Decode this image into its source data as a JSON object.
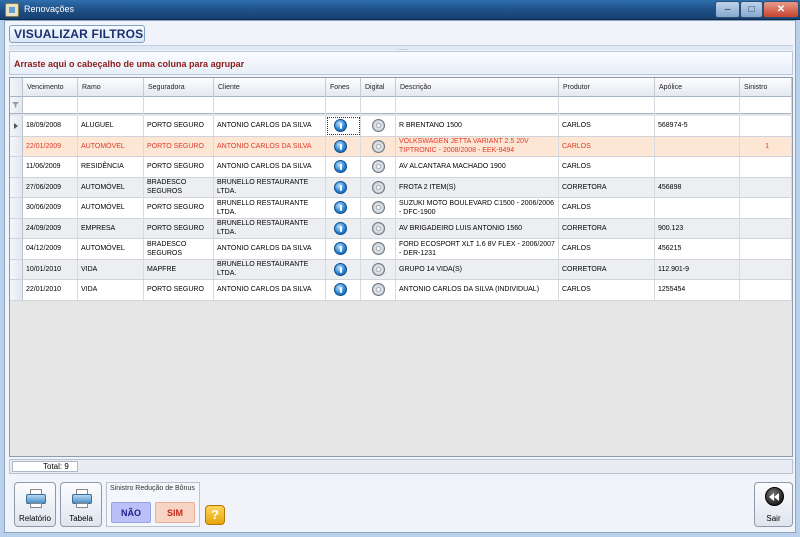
{
  "window": {
    "title": "Renovações",
    "minimize_label": "–",
    "maximize_label": "□",
    "close_label": "✕"
  },
  "toolbar": {
    "header_label": "VISUALIZAR FILTROS",
    "splitter_glyph": "....."
  },
  "grid": {
    "group_hint": "Arraste aqui o cabeçalho de uma coluna para agrupar",
    "columns": [
      "Vencimento",
      "Ramo",
      "Seguradora",
      "Cliente",
      "Fones",
      "Digital",
      "Descrição",
      "Produtor",
      "Apólice",
      "Sinistro"
    ],
    "rows": [
      {
        "vencimento": "18/09/2008",
        "ramo": "ALUGUEL",
        "seguradora": "PORTO SEGURO",
        "cliente": "ANTONIO CARLOS DA SILVA",
        "descricao": "R BRENTANO 1500",
        "produtor": "CARLOS",
        "apolice": "568974-5",
        "sinistro": ""
      },
      {
        "vencimento": "22/01/2009",
        "ramo": "AUTOMÓVEL",
        "seguradora": "PORTO SEGURO",
        "cliente": "ANTONIO CARLOS DA SILVA",
        "descricao": "VOLKSWAGEN JETTA VARIANT 2.5 20V TIPTRONIC - 2008/2008 - EEK-9494",
        "produtor": "CARLOS",
        "apolice": "",
        "sinistro": "1"
      },
      {
        "vencimento": "11/06/2009",
        "ramo": "RESIDÊNCIA",
        "seguradora": "PORTO SEGURO",
        "cliente": "ANTONIO CARLOS DA SILVA",
        "descricao": "AV ALCANTARA MACHADO 1900",
        "produtor": "CARLOS",
        "apolice": "",
        "sinistro": ""
      },
      {
        "vencimento": "27/06/2009",
        "ramo": "AUTOMÓVEL",
        "seguradora": "BRADESCO SEGUROS",
        "cliente": "BRUNELLO RESTAURANTE LTDA.",
        "descricao": "FROTA 2 ITEM(S)",
        "produtor": "CORRETORA",
        "apolice": "456898",
        "sinistro": ""
      },
      {
        "vencimento": "30/06/2009",
        "ramo": "AUTOMÓVEL",
        "seguradora": "PORTO SEGURO",
        "cliente": "BRUNELLO RESTAURANTE LTDA.",
        "descricao": "SUZUKI MOTO BOULEVARD C1500 - 2006/2006 - DFC-1900",
        "produtor": "CARLOS",
        "apolice": "",
        "sinistro": ""
      },
      {
        "vencimento": "24/09/2009",
        "ramo": "EMPRESA",
        "seguradora": "PORTO SEGURO",
        "cliente": "BRUNELLO RESTAURANTE LTDA.",
        "descricao": "AV BRIGADEIRO LUIS ANTONIO 1560",
        "produtor": "CORRETORA",
        "apolice": "900.123",
        "sinistro": ""
      },
      {
        "vencimento": "04/12/2009",
        "ramo": "AUTOMÓVEL",
        "seguradora": "BRADESCO SEGUROS",
        "cliente": "ANTONIO CARLOS DA SILVA",
        "descricao": "FORD ECOSPORT XLT 1.6 8V FLEX - 2006/2007 - DER-1231",
        "produtor": "CARLOS",
        "apolice": "456215",
        "sinistro": ""
      },
      {
        "vencimento": "10/01/2010",
        "ramo": "VIDA",
        "seguradora": "MAPFRE",
        "cliente": "BRUNELLO RESTAURANTE LTDA.",
        "descricao": "GRUPO 14 VIDA(S)",
        "produtor": "CORRETORA",
        "apolice": "112.901-9",
        "sinistro": ""
      },
      {
        "vencimento": "22/01/2010",
        "ramo": "VIDA",
        "seguradora": "PORTO SEGURO",
        "cliente": "ANTONIO CARLOS DA SILVA",
        "descricao": "ANTONIO CARLOS DA SILVA (INDIVIDUAL)",
        "produtor": "CARLOS",
        "apolice": "1255454",
        "sinistro": ""
      }
    ],
    "fones_icon": "phone-info-icon",
    "digital_icon": "cd-disc-icon"
  },
  "footer": {
    "total_label": "Total: 9"
  },
  "buttons": {
    "relatorio": "Relatório",
    "tabela": "Tabela",
    "sair": "Sair"
  },
  "legend": {
    "caption": "Sinistro Redução de Bônus",
    "nao": "NÃO",
    "sim": "SIM",
    "help": "?"
  },
  "colors": {
    "highlight_row_bg": "#fde6d4",
    "highlight_row_text": "#e0392b",
    "title_accent": "#1b2f6e",
    "group_hint": "#8b1a1a"
  }
}
